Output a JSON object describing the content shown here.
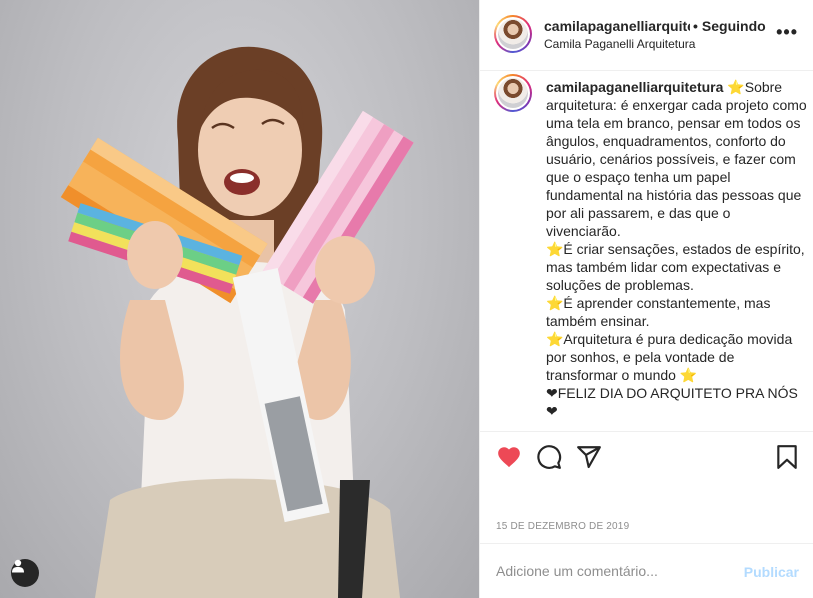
{
  "post": {
    "photo_alt": "",
    "user_tag_icon": "user-silhouette-icon"
  },
  "header": {
    "username": "camilapaganelliarquite",
    "separator": "•",
    "follow_label": "Seguindo",
    "subtitle": "Camila Paganelli Arquitetura",
    "more_icon": "ellipsis-icon",
    "more_label": "•••"
  },
  "caption": {
    "username": "camilapaganelliarquitetura",
    "text": " ⭐Sobre arquitetura: é enxergar cada projeto como uma tela em branco, pensar em todos os ângulos, enquadramentos, conforto do usuário, cenários possíveis, e fazer com que o espaço tenha um papel fundamental na história das pessoas que por ali passarem, e das que o vivenciarão.\n⭐É criar sensações, estados de espírito, mas também lidar com expectativas e soluções de problemas.\n⭐É aprender constantemente, mas também ensinar.\n⭐Arquitetura é pura dedicação movida por sonhos, e pela vontade de transformar o mundo ⭐\n❤FELIZ DIA DO ARQUITETO PRA NÓS❤"
  },
  "actions": {
    "like_icon": "heart-filled-icon",
    "comment_icon": "comment-bubble-icon",
    "share_icon": "paper-plane-icon",
    "save_icon": "bookmark-icon",
    "like_color": "#ed4956"
  },
  "date": "15 de dezembro de 2019",
  "comment_box": {
    "placeholder": "Adicione um comentário...",
    "post_label": "Publicar",
    "post_color": "#b3dbff"
  }
}
